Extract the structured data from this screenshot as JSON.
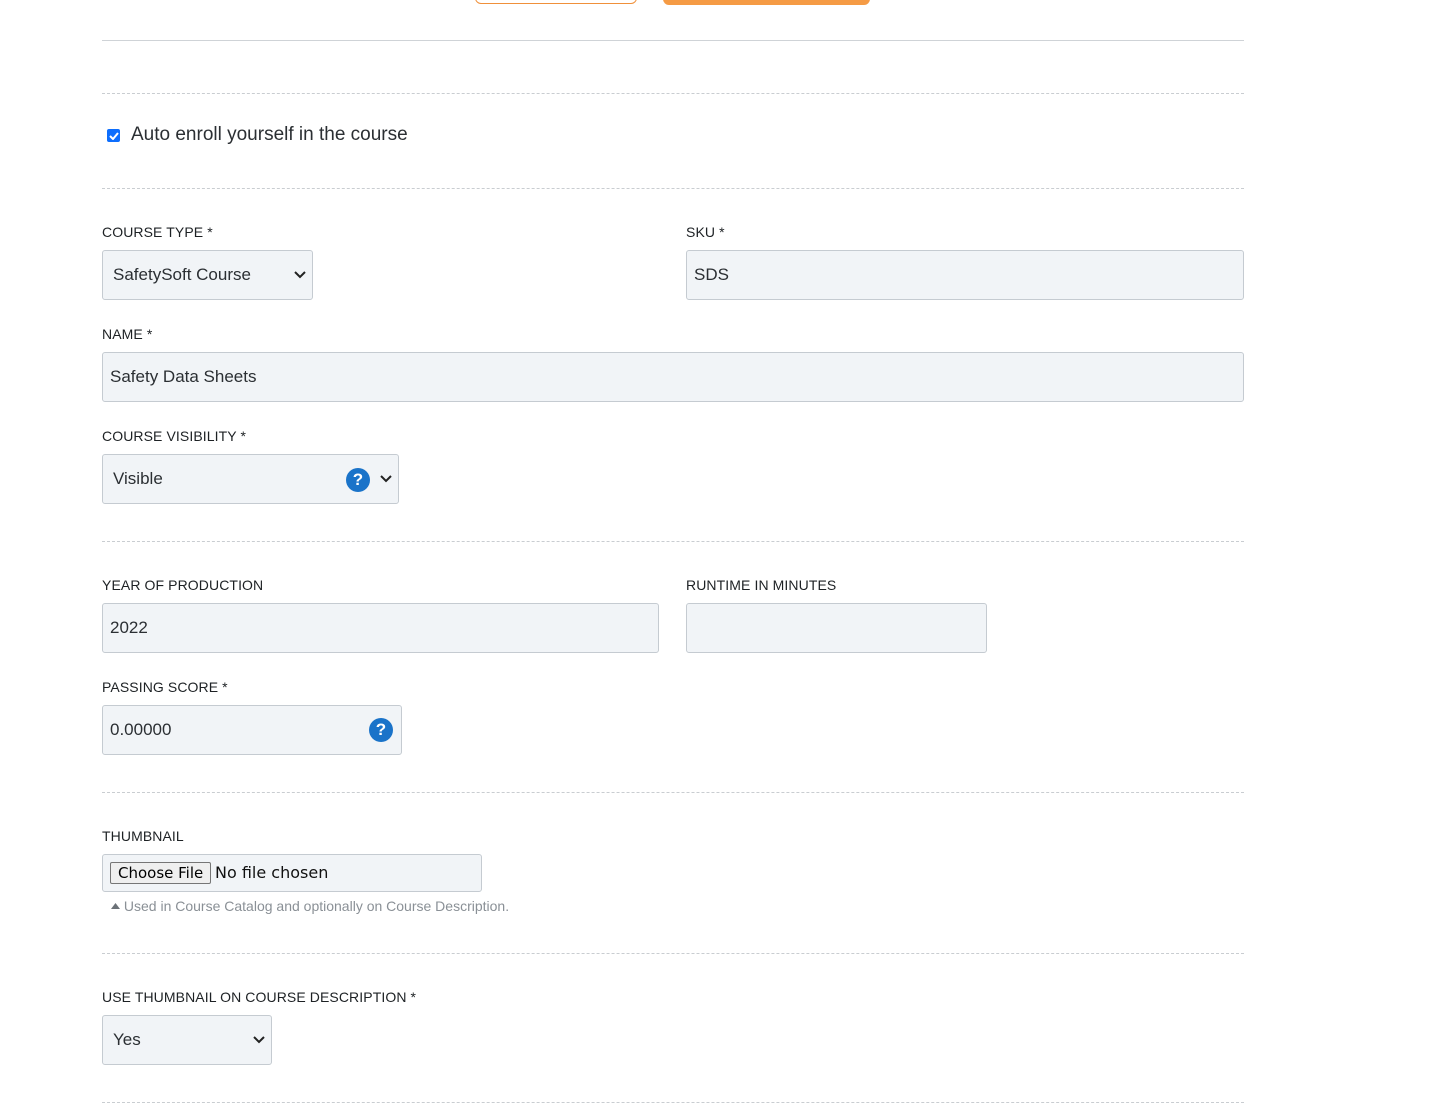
{
  "auto_enroll": {
    "label": "Auto enroll yourself in the course",
    "checked": true
  },
  "course_type": {
    "label": "COURSE TYPE *",
    "value": "SafetySoft Course"
  },
  "sku": {
    "label": "SKU *",
    "value": "SDS"
  },
  "name": {
    "label": "NAME *",
    "value": "Safety Data Sheets"
  },
  "course_visibility": {
    "label": "COURSE VISIBILITY *",
    "value": "Visible",
    "help_icon": "?"
  },
  "year_of_production": {
    "label": "YEAR OF PRODUCTION",
    "value": "2022"
  },
  "runtime_in_minutes": {
    "label": "RUNTIME IN MINUTES",
    "value": ""
  },
  "passing_score": {
    "label": "PASSING SCORE *",
    "value": "0.00000",
    "help_icon": "?"
  },
  "thumbnail": {
    "label": "THUMBNAIL",
    "button_label": "Choose File",
    "status": "No file chosen",
    "hint": "Used in Course Catalog and optionally on Course Description."
  },
  "use_thumbnail": {
    "label": "USE THUMBNAIL ON COURSE DESCRIPTION *",
    "value": "Yes"
  },
  "colors": {
    "accent": "#f59b45",
    "help": "#1a73c9",
    "checkbox": "#0d6efd",
    "field_bg": "#f1f4f7"
  }
}
